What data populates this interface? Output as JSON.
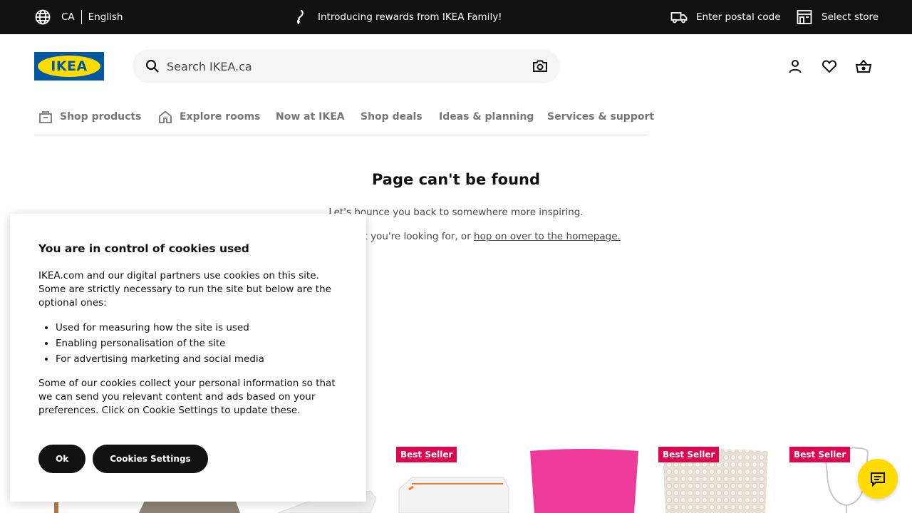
{
  "topbar": {
    "country": "CA",
    "language": "English",
    "promo": "Introducing rewards from IKEA Family!",
    "postal": "Enter postal code",
    "store": "Select store"
  },
  "header": {
    "logo_text": "IKEA",
    "search_placeholder": "Search IKEA.ca"
  },
  "nav": {
    "items": [
      {
        "label": "Shop products",
        "icon": "shopping-bag-icon"
      },
      {
        "label": "Explore rooms",
        "icon": "home-icon"
      },
      {
        "label": "Now at IKEA"
      },
      {
        "label": "Shop deals"
      },
      {
        "label": "Ideas & planning"
      },
      {
        "label": "Services & support"
      }
    ]
  },
  "main": {
    "title": "Page can't be found",
    "subtitle": "Let's bounce you back to somewhere more inspiring.",
    "line2_prefix": "Search for what you're looking for, or ",
    "line2_link": "hop on over to the homepage."
  },
  "products": {
    "badge": "Best Seller"
  },
  "cookie": {
    "title": "You are in control of cookies used",
    "intro": "IKEA.com and our digital partners use cookies on this site. Some are strictly necessary to run the site but below are the optional ones:",
    "bullets": [
      "Used for measuring how the site is used",
      "Enabling personalisation of the site",
      "For advertising marketing and social media"
    ],
    "outro": "Some of our cookies collect your personal information so that we can send you relevant content and ads based on your preferences. Click on Cookie Settings to update these.",
    "ok_label": "Ok",
    "settings_label": "Cookies Settings"
  },
  "colors": {
    "brand_blue": "#0058a3",
    "brand_yellow": "#ffdb00",
    "badge_red": "#e00751"
  }
}
